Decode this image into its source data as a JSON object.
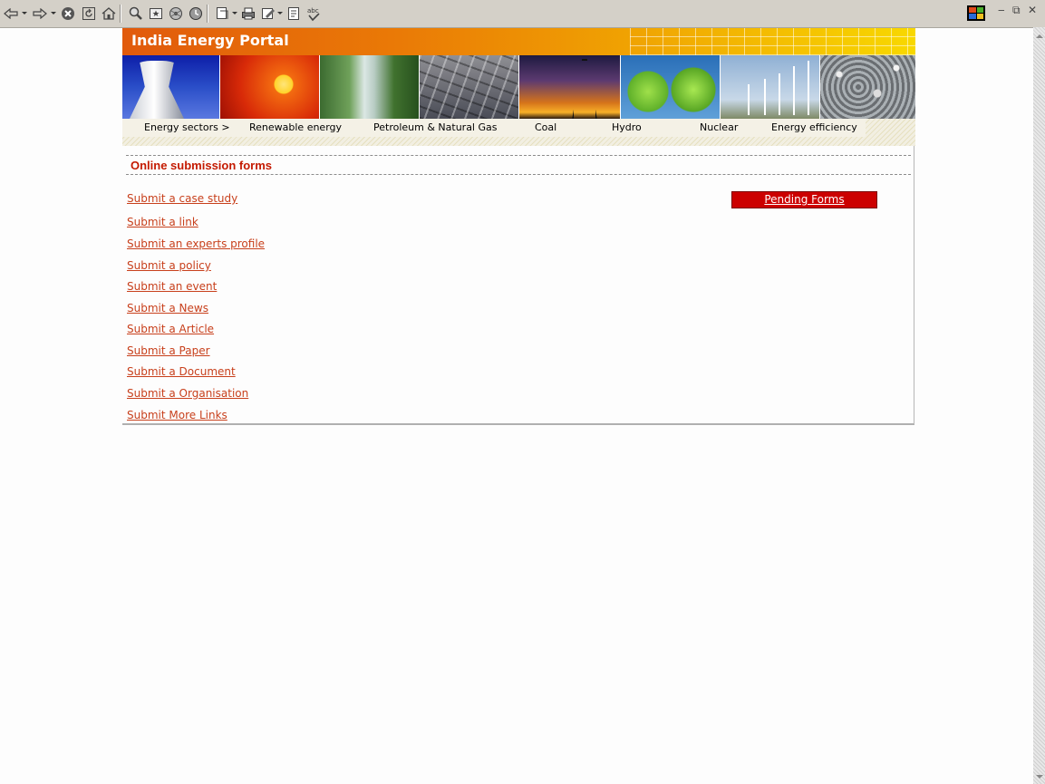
{
  "browser": {
    "toolbar_icons": [
      "back-arrow-icon",
      "forward-arrow-icon",
      "stop-icon",
      "refresh-icon",
      "home-icon",
      "search-icon",
      "favorites-icon",
      "media-icon",
      "history-icon",
      "fullscreen-icon",
      "print-icon",
      "edit-icon",
      "discuss-icon",
      "spellcheck-icon"
    ]
  },
  "site": {
    "banner_title": "India Energy Portal",
    "nav": [
      "Energy sectors >",
      "Renewable energy",
      "Petroleum & Natural Gas",
      "Coal",
      "Hydro",
      "Nuclear",
      "Energy efficiency"
    ]
  },
  "main": {
    "section_title": "Online submission forms",
    "pending_button": "Pending Forms",
    "links": [
      "Submit a case study",
      "Submit a link",
      "Submit an experts profile",
      "Submit a policy",
      "Submit an event",
      "Submit a News",
      "Submit a Article",
      "Submit a Paper",
      "Submit a Document",
      "Submit a Organisation",
      "Submit More Links"
    ]
  },
  "colors": {
    "link": "#c8401c",
    "section_title": "#c41a00",
    "pending_bg": "#cc0000"
  }
}
